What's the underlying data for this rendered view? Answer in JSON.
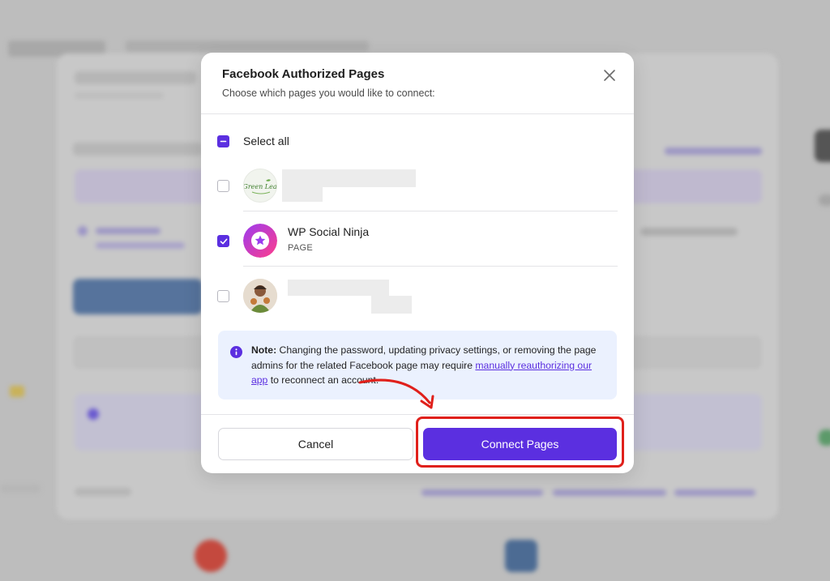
{
  "modal": {
    "title": "Facebook Authorized Pages",
    "subtitle": "Choose which pages you would like to connect:",
    "select_all_label": "Select all",
    "pages": [
      {
        "name": "",
        "type": "",
        "checked": false,
        "avatar": "green-leaf-logo",
        "avatar_text": "Green Leaf"
      },
      {
        "name": "WP Social Ninja",
        "type": "PAGE",
        "checked": true,
        "avatar": "wp-social-ninja-logo"
      },
      {
        "name": "",
        "type": "",
        "checked": false,
        "avatar": "person-photo"
      }
    ],
    "note": {
      "label": "Note:",
      "text_before": " Changing the password, updating privacy settings, or removing the page admins for the related Facebook page may require ",
      "link": "manually reauthorizing our app",
      "text_after": " to reconnect an account."
    },
    "cancel_label": "Cancel",
    "connect_label": "Connect Pages"
  },
  "colors": {
    "accent": "#5b2fe0",
    "note_bg": "#ebf1fe",
    "annotation": "#e0201b"
  },
  "icons": [
    "close-icon",
    "info-icon",
    "check-icon",
    "minus-icon"
  ]
}
